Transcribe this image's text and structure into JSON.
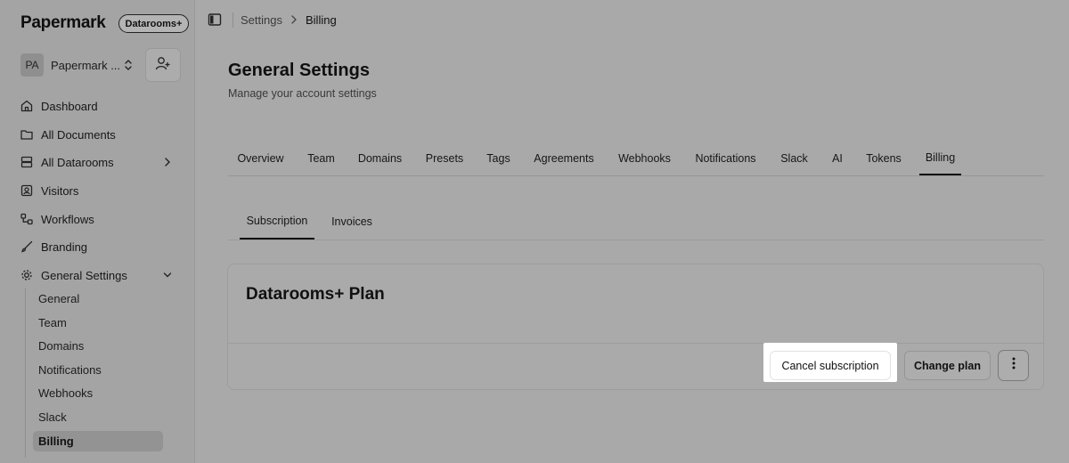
{
  "sidebar": {
    "brand": "Papermark",
    "plan_badge": "Datarooms+",
    "team": {
      "initials": "PA",
      "name": "Papermark ..."
    },
    "nav": [
      {
        "label": "Dashboard",
        "icon": "home-icon"
      },
      {
        "label": "All Documents",
        "icon": "folder-icon"
      },
      {
        "label": "All Datarooms",
        "icon": "server-icon"
      },
      {
        "label": "Visitors",
        "icon": "contact-icon"
      },
      {
        "label": "Workflows",
        "icon": "workflow-icon"
      },
      {
        "label": "Branding",
        "icon": "brush-icon"
      },
      {
        "label": "General Settings",
        "icon": "gear-icon"
      }
    ],
    "settings_sub": [
      "General",
      "Team",
      "Domains",
      "Notifications",
      "Webhooks",
      "Slack",
      "Billing"
    ]
  },
  "breadcrumb": {
    "parent": "Settings",
    "current": "Billing"
  },
  "page": {
    "title": "General Settings",
    "subtitle": "Manage your account settings"
  },
  "tabs": [
    "Overview",
    "Team",
    "Domains",
    "Presets",
    "Tags",
    "Agreements",
    "Webhooks",
    "Notifications",
    "Slack",
    "AI",
    "Tokens",
    "Billing"
  ],
  "subtabs": [
    "Subscription",
    "Invoices"
  ],
  "plan_card": {
    "title": "Datarooms+ Plan",
    "cancel_label": "Cancel subscription",
    "change_label": "Change plan"
  }
}
